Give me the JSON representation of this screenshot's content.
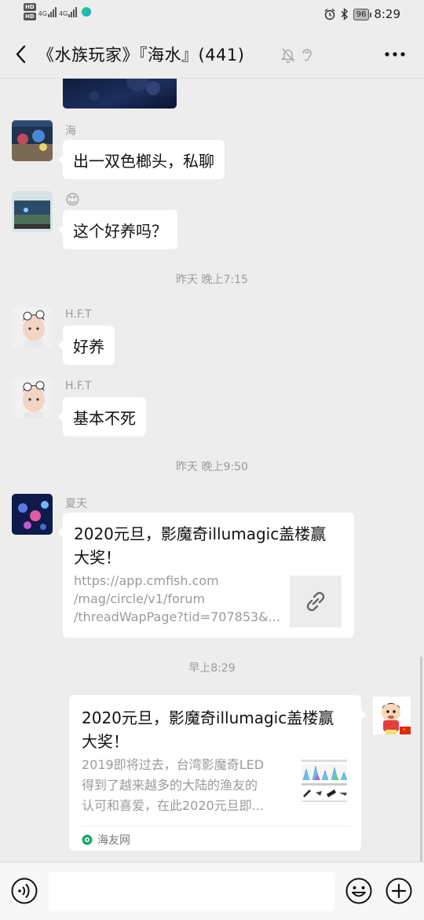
{
  "status_bar": {
    "hd_top": "HD",
    "hd_bottom": "HD",
    "net1": "4G",
    "net2": "4G",
    "battery": "96",
    "time": "8:29"
  },
  "header": {
    "title": "《水族玩家》『海水』(441)"
  },
  "chat": {
    "messages": [
      {
        "nick": "海",
        "text": "出一双色榔头，私聊"
      },
      {
        "nick": "😊",
        "text": "这个好养吗？"
      },
      {
        "time": "昨天 晚上7:15"
      },
      {
        "nick": "H.F.T",
        "text": "好养"
      },
      {
        "nick": "H.F.T",
        "text": "基本不死"
      },
      {
        "time": "昨天 晚上9:50"
      },
      {
        "nick": "夏天",
        "title_line1": "2020元旦，影魔奇illumagic盖楼赢",
        "title_line2": "大奖！",
        "url_line1": "https://app.cmfish.com",
        "url_line2": "/mag/circle/v1/forum",
        "url_line3": "/threadWapPage?tid=707853&..."
      },
      {
        "time": "早上8:29"
      },
      {
        "title_line1": "2020元旦，影魔奇illumagic盖楼赢",
        "title_line2": "大奖！",
        "desc_line1": "2019即将过去，台湾影魔奇LED",
        "desc_line2": "得到了越来越多的大陆的渔友的",
        "desc_line3": "认可和喜爱，在此2020元旦即...",
        "source": "海友网"
      }
    ]
  },
  "input_bar": {
    "placeholder": ""
  },
  "colors": {
    "background": "#ededed",
    "bubble": "#ffffff",
    "muted_text": "#9b9b9b",
    "source_logo": "#1aa76b"
  }
}
